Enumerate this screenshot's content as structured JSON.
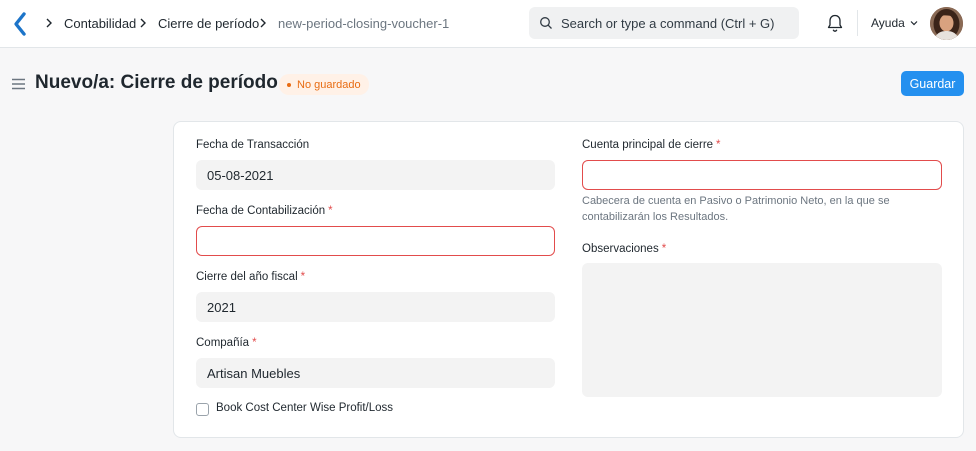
{
  "breadcrumbs": [
    "Contabilidad",
    "Cierre de período",
    "new-period-closing-voucher-1"
  ],
  "search": {
    "placeholder": "Search or type a command (Ctrl + G)"
  },
  "navbar": {
    "help_label": "Ayuda"
  },
  "page": {
    "title": "Nuevo/a: Cierre de período",
    "status": "No guardado",
    "save_label": "Guardar"
  },
  "form": {
    "transaction_date": {
      "label": "Fecha de Transacción",
      "value": "05-08-2021"
    },
    "posting_date": {
      "label": "Fecha de Contabilización",
      "required": "*",
      "value": ""
    },
    "fiscal_year": {
      "label": "Cierre del año fiscal",
      "required": "*",
      "value": "2021"
    },
    "company": {
      "label": "Compañía",
      "required": "*",
      "value": "Artisan Muebles"
    },
    "cost_center_wise": {
      "label": "Book Cost Center Wise Profit/Loss",
      "checked": false
    },
    "closing_account": {
      "label": "Cuenta principal de cierre",
      "required": "*",
      "value": "",
      "description": "Cabecera de cuenta en Pasivo o Patrimonio Neto, en la que se contabilizarán los Resultados."
    },
    "remarks": {
      "label": "Observaciones",
      "required": "*",
      "value": ""
    }
  },
  "colors": {
    "primary": "#2490ef",
    "error": "#e24c4c",
    "warning": "#e86c13",
    "badge_bg": "#fff1e7"
  }
}
